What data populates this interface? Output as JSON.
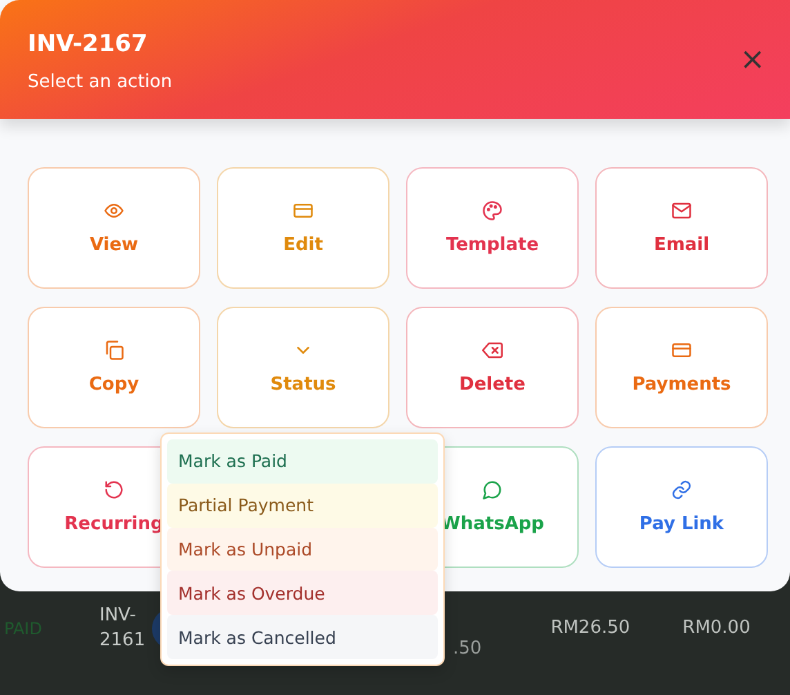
{
  "background_row": {
    "status": "PAID",
    "invoice_lines": [
      "INV-",
      "2161"
    ],
    "amount_partial": ".50",
    "total": "RM26.50",
    "balance": "RM0.00"
  },
  "modal": {
    "title": "INV-2167",
    "subtitle": "Select an action",
    "close": "×"
  },
  "actions": [
    {
      "label": "View",
      "kind": "eye",
      "color": "#ea6a12"
    },
    {
      "label": "Edit",
      "kind": "card",
      "color": "#e08a0c"
    },
    {
      "label": "Template",
      "kind": "palette",
      "color": "#e3334f"
    },
    {
      "label": "Email",
      "kind": "mail",
      "color": "#e0303f"
    },
    {
      "label": "Copy",
      "kind": "copy",
      "color": "#ea6a12"
    },
    {
      "label": "Status",
      "kind": "chevron",
      "color": "#e08a0c"
    },
    {
      "label": "Delete",
      "kind": "backspace",
      "color": "#e0303f"
    },
    {
      "label": "Payments",
      "kind": "card",
      "color": "#ea6a12"
    },
    {
      "label": "Recurring",
      "kind": "refresh",
      "color": "#e3334f"
    },
    {
      "kind": "hidden"
    },
    {
      "label": "WhatsApp",
      "kind": "chat",
      "color": "#1aa34a"
    },
    {
      "label": "Pay Link",
      "kind": "link",
      "color": "#2f6fe6"
    }
  ],
  "status_menu": [
    {
      "label": "Mark as Paid",
      "kind": "paid"
    },
    {
      "label": "Partial Payment",
      "kind": "partial"
    },
    {
      "label": "Mark as Unpaid",
      "kind": "unpaid"
    },
    {
      "label": "Mark as Overdue",
      "kind": "overdue"
    },
    {
      "label": "Mark as Cancelled",
      "kind": "cancelled"
    }
  ]
}
